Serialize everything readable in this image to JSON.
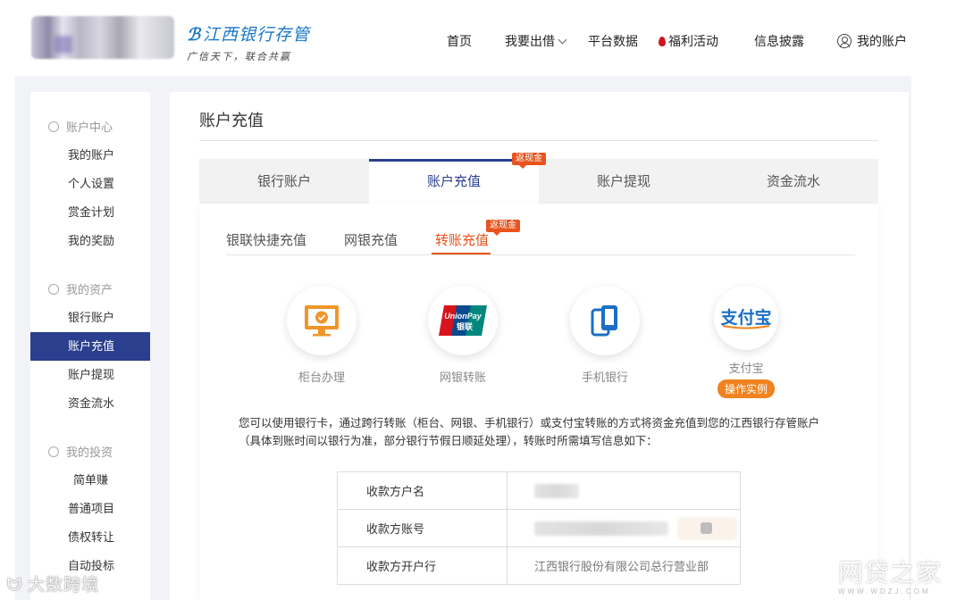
{
  "header": {
    "brand_name": "江西银行存管",
    "brand_slogan": "广信天下，联合共赢",
    "nav": [
      "首页",
      "我要出借",
      "平台数据",
      "福利活动",
      "信息披露",
      "我的账户"
    ]
  },
  "sidebar": {
    "groups": [
      {
        "title": "账户中心",
        "items": [
          "我的账户",
          "个人设置",
          "赏金计划",
          "我的奖励"
        ]
      },
      {
        "title": "我的资产",
        "items": [
          "银行账户",
          "账户充值",
          "账户提现",
          "资金流水"
        ]
      },
      {
        "title": "我的投资",
        "items": [
          "简单赚",
          "普通项目",
          "债权转让",
          "自动投标"
        ]
      }
    ],
    "active_item": "账户充值"
  },
  "main": {
    "title": "账户充值",
    "tabs": [
      "银行账户",
      "账户充值",
      "账户提现",
      "资金流水"
    ],
    "active_tab": "账户充值",
    "tab_badge": "返现金",
    "subtabs": [
      "银联快捷充值",
      "网银充值",
      "转账充值"
    ],
    "active_subtab": "转账充值",
    "subtab_badge": "返现金",
    "methods": [
      {
        "label": "柜台办理",
        "icon": "monitor-check-icon"
      },
      {
        "label": "网银转账",
        "icon": "unionpay-icon"
      },
      {
        "label": "手机银行",
        "icon": "phone-icon"
      },
      {
        "label": "支付宝",
        "icon": "alipay-icon",
        "action": "操作实例"
      }
    ],
    "unionpay_logo": {
      "line1": "UnionPay",
      "line2": "银联"
    },
    "alipay_logo": "支付宝",
    "description_line1": "您可以使用银行卡，通过跨行转账（柜台、网银、手机银行）或支付宝转账的方式将资金充值到您的江西银行存管账户",
    "description_line2": "（具体到账时间以银行为准，部分银行节假日顺延处理），转账时所需填写信息如下：",
    "info_rows": [
      {
        "key": "收款方户名",
        "value": ""
      },
      {
        "key": "收款方账号",
        "value": ""
      },
      {
        "key": "收款方开户行",
        "value": "江西银行股份有限公司总行营业部"
      }
    ]
  },
  "watermarks": {
    "left": "大数跨境",
    "right": "网贷之家",
    "right_sub": "WWW.WDZJ.COM"
  },
  "colors": {
    "primary": "#2a3f8e",
    "accent": "#e9531d",
    "brand": "#1a77c8"
  }
}
